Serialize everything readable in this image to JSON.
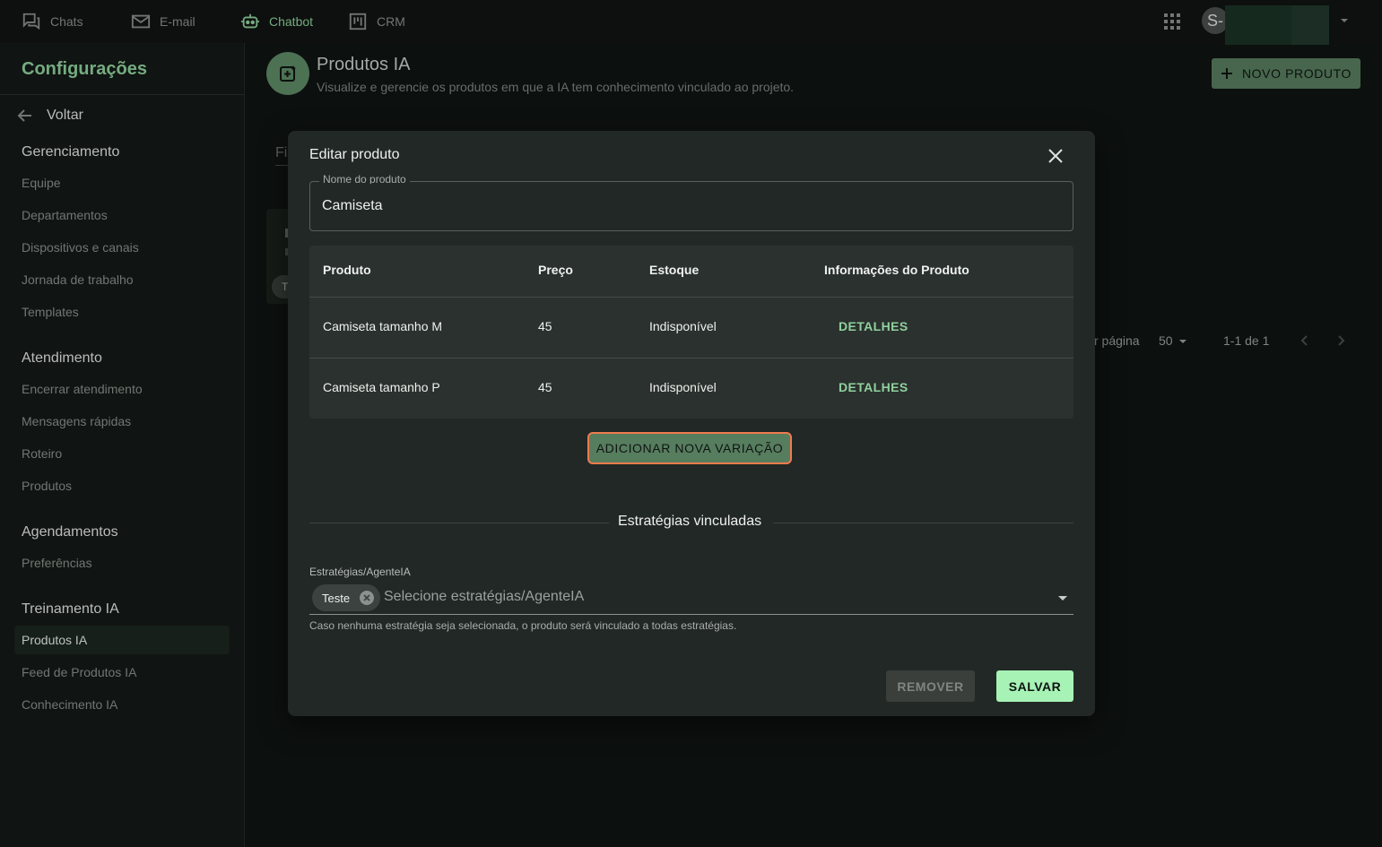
{
  "nav": {
    "items": [
      {
        "label": "Chats",
        "icon": "chat-bubbles-icon"
      },
      {
        "label": "E-mail",
        "icon": "mail-icon"
      },
      {
        "label": "Chatbot",
        "icon": "robot-icon",
        "active": true
      },
      {
        "label": "CRM",
        "icon": "kanban-icon"
      }
    ],
    "avatar_initial": "S-"
  },
  "sidebar": {
    "title": "Configurações",
    "back_label": "Voltar",
    "sections": {
      "gerenciamento": {
        "title": "Gerenciamento",
        "items": [
          "Equipe",
          "Departamentos",
          "Dispositivos e canais",
          "Jornada de trabalho",
          "Templates"
        ]
      },
      "atendimento": {
        "title": "Atendimento",
        "items": [
          "Encerrar atendimento",
          "Mensagens rápidas",
          "Roteiro",
          "Produtos"
        ]
      },
      "agendamentos": {
        "title": "Agendamentos",
        "items": [
          "Preferências"
        ]
      },
      "treinamento": {
        "title": "Treinamento IA",
        "items": [
          "Produtos IA",
          "Feed de Produtos IA",
          "Conhecimento IA"
        ],
        "active": "Produtos IA"
      }
    }
  },
  "page": {
    "title": "Produtos IA",
    "subtitle": "Visualize e gerencie os produtos em que a IA tem conhecimento vinculado ao projeto.",
    "new_button": "NOVO PRODUTO",
    "filter_partial": "Fi",
    "card_chip_partial": "T",
    "pagination": {
      "per_page_label": "r página",
      "per_page_value": "50",
      "range": "1-1 de 1"
    }
  },
  "modal": {
    "title": "Editar produto",
    "name_label": "Nome do produto",
    "name_value": "Camiseta",
    "table": {
      "headers": [
        "Produto",
        "Preço",
        "Estoque",
        "Informações do Produto"
      ],
      "rows": [
        {
          "produto": "Camiseta tamanho M",
          "preco": "45",
          "estoque": "Indisponível",
          "info": "DETALHES"
        },
        {
          "produto": "Camiseta tamanho P",
          "preco": "45",
          "estoque": "Indisponível",
          "info": "DETALHES"
        }
      ]
    },
    "add_variation": "ADICIONAR NOVA VARIAÇÃO",
    "strategies_heading": "Estratégias vinculadas",
    "strategies_label": "Estratégias/AgenteIA",
    "strategies_chip": "Teste",
    "strategies_placeholder": "Selecione estratégias/AgenteIA",
    "strategies_help": "Caso nenhuma estratégia seja selecionada, o produto será vinculado a todas estratégias.",
    "remove_button": "REMOVER",
    "save_button": "SALVAR"
  },
  "colors": {
    "accent": "#8fd19e",
    "button_green": "#577d5f",
    "save_green": "#a6f3b5",
    "highlight_border": "#ef7b4e",
    "modal_bg": "#222826",
    "app_bg": "#0f1412"
  }
}
